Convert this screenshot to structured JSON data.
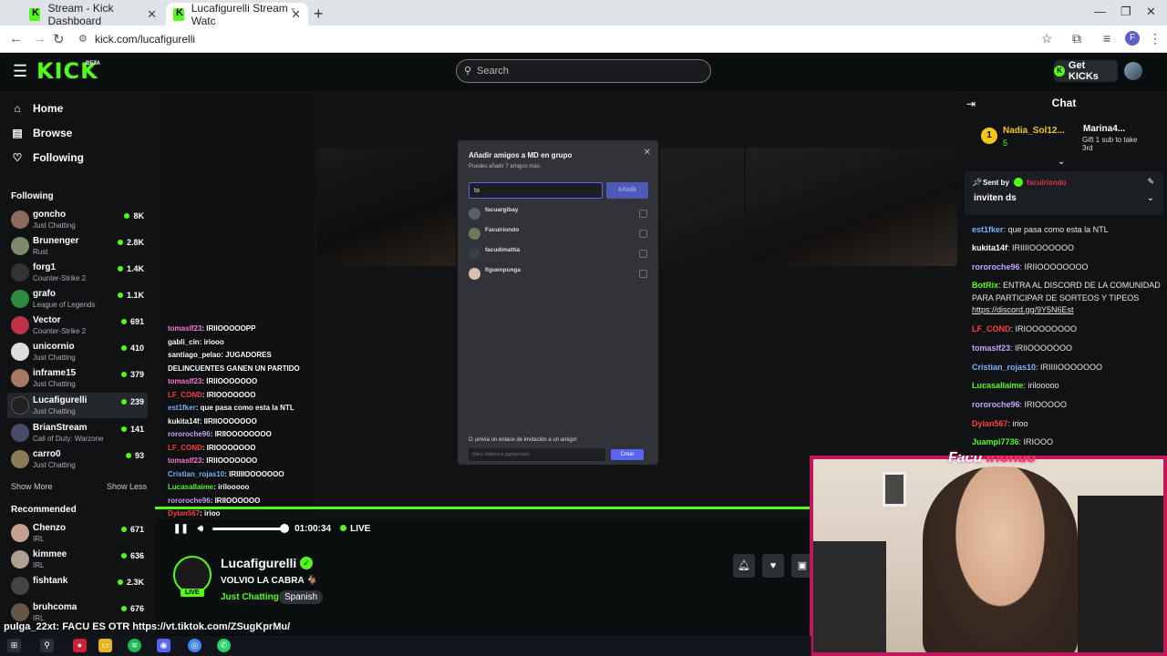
{
  "browser": {
    "tabs": [
      {
        "title": "Stream - Kick Dashboard"
      },
      {
        "title": "Lucafigurelli Stream - Watc"
      }
    ],
    "url": "kick.com/lucafigurelli",
    "profile_letter": "F"
  },
  "header": {
    "logo": "KICK",
    "beta": "BETA",
    "search_placeholder": "Search",
    "get_kicks": "Get KICKs"
  },
  "sidebar": {
    "nav": [
      {
        "label": "Home",
        "icon": "home-icon"
      },
      {
        "label": "Browse",
        "icon": "browse-icon"
      },
      {
        "label": "Following",
        "icon": "heart-icon"
      }
    ],
    "following_title": "Following",
    "following": [
      {
        "name": "goncho",
        "category": "Just Chatting",
        "viewers": "8K"
      },
      {
        "name": "Brunenger",
        "category": "Rust",
        "viewers": "2.8K"
      },
      {
        "name": "forg1",
        "category": "Counter-Strike 2",
        "viewers": "1.4K"
      },
      {
        "name": "grafo",
        "category": "League of Legends",
        "viewers": "1.1K"
      },
      {
        "name": "Vector",
        "category": "Counter-Strike 2",
        "viewers": "691"
      },
      {
        "name": "unicornio",
        "category": "Just Chatting",
        "viewers": "410"
      },
      {
        "name": "inframe15",
        "category": "Just Chatting",
        "viewers": "379"
      },
      {
        "name": "Lucafigurelli",
        "category": "Just Chatting",
        "viewers": "239"
      },
      {
        "name": "BrianStream",
        "category": "Call of Duty: Warzone",
        "viewers": "141"
      },
      {
        "name": "carro0",
        "category": "Just Chatting",
        "viewers": "93"
      }
    ],
    "show_more": "Show More",
    "show_less": "Show Less",
    "recommended_title": "Recommended",
    "recommended": [
      {
        "name": "Chenzo",
        "category": "IRL",
        "viewers": "671"
      },
      {
        "name": "kimmee",
        "category": "IRL",
        "viewers": "636"
      },
      {
        "name": "fishtank",
        "category": "",
        "viewers": "2.3K"
      },
      {
        "name": "bruhcoma",
        "category": "IRL",
        "viewers": "676"
      }
    ]
  },
  "discord_modal": {
    "title": "Añadir amigos a MD en grupo",
    "subtitle": "Puedes añadir 7 amigos más.",
    "input_value": "fa",
    "add_button": "Añadir",
    "friends": [
      {
        "name": "facuargibay"
      },
      {
        "name": "Facuiriondo"
      },
      {
        "name": "facudimattia"
      },
      {
        "name": "figuenpunga"
      }
    ],
    "invite_label": "O ¡envía un enlace de invitación a un amigo!",
    "invite_placeholder": "https://discord.gg/ejemplo",
    "create_button": "Crear"
  },
  "stream_overlay_chat": [
    {
      "user": "tomaslf23",
      "text": ": IRIIOOOOOPP",
      "color": "#ff7ad9"
    },
    {
      "user": "gabli_cin",
      "text": ": iriooo",
      "color": "#ffffff"
    },
    {
      "user": "santiago_pelao",
      "text": ": JUGADORES",
      "color": "#ffffff"
    },
    {
      "user": "",
      "text": "DELINCUENTES GANEN UN PARTIDO",
      "color": "#ffffff"
    },
    {
      "user": "tomaslf23",
      "text": ": IRIIOOOOOOO",
      "color": "#ff7ad9"
    },
    {
      "user": "LF_COND",
      "text": ": IRIOOOOOOO",
      "color": "#ff4040"
    },
    {
      "user": "est1fker",
      "text": ": que pasa como esta la NTL",
      "color": "#7ab4ff"
    },
    {
      "user": "kukita14f",
      "text": ": IIRIIOOOOOOO",
      "color": "#ffffff"
    },
    {
      "user": "rororoche96",
      "text": ": IRIIOOOOOOOO",
      "color": "#c7a3ff"
    },
    {
      "user": "LF_COND",
      "text": ": IRIOOOOOOO",
      "color": "#ff4040"
    },
    {
      "user": "tomaslf23",
      "text": ": IRIIOOOOOOO",
      "color": "#ff7ad9"
    },
    {
      "user": "Cristian_rojas10",
      "text": ": IRIIIIOOOOOOO",
      "color": "#7ab4ff"
    },
    {
      "user": "Lucasallaime",
      "text": ": irilooooo",
      "color": "#53fc18"
    },
    {
      "user": "rororoche96",
      "text": ": IRIIOOOOOO",
      "color": "#c7a3ff"
    },
    {
      "user": "Dylan567",
      "text": ": irioo",
      "color": "#ff4040"
    }
  ],
  "player": {
    "time": "01:00:34",
    "live": "LIVE",
    "volume_percent": 100
  },
  "channel": {
    "name": "Lucafigurelli",
    "live_badge": "LIVE",
    "title": "VOLVIO LA CABRA 🐐",
    "category": "Just Chatting",
    "language": "Spanish"
  },
  "webcam": {
    "title_first": "Facu ",
    "title_second": "Iriondo"
  },
  "chat": {
    "title": "Chat",
    "leaderboard": [
      {
        "rank": "1",
        "user": "Nadia_Sol12...",
        "count": "5"
      },
      {
        "user": "Marina4...",
        "line1": "Gift 1 sub to take",
        "line2": "3rd"
      }
    ],
    "pinned_sender_label": "Sent by",
    "pinned_sender": "facuiriondo",
    "pinned_text": "inviten ds",
    "messages": [
      {
        "user": "est1fker",
        "text": ": que pasa como esta la NTL",
        "color": "#7ab4ff"
      },
      {
        "user": "kukita14f",
        "text": ": IRIIIIOOOOOOO",
        "color": "#ffffff"
      },
      {
        "user": "rororoche96",
        "text": ": IRIIOOOOOOOO",
        "color": "#c7a3ff"
      },
      {
        "user": "BotRix",
        "text": ": ENTRA AL DISCORD DE LA COMUNIDAD PARA PARTICIPAR DE SORTEOS Y TIPEOS ",
        "link": "https://discord.gg/9Y5N6Est",
        "color": "#53fc18"
      },
      {
        "user": "LF_COND",
        "text": ": IRIOOOOOOOO",
        "color": "#ff4040"
      },
      {
        "user": "tomaslf23",
        "text": ": IRIIOOOOOOO",
        "color": "#c7a3ff"
      },
      {
        "user": "Cristian_rojas10",
        "text": ": IRIIIIOOOOOOO",
        "color": "#7ab4ff"
      },
      {
        "user": "Lucasallaime",
        "text": ": irilooooo",
        "color": "#53fc18"
      },
      {
        "user": "rororoche96",
        "text": ": IRIOOOOO",
        "color": "#c7a3ff"
      },
      {
        "user": "Dylan567",
        "text": ": irioo",
        "color": "#ff4040"
      },
      {
        "user": "Juampi7736",
        "text": ": IRIOOO",
        "color": "#53fc18"
      }
    ]
  },
  "bottom_overlay": {
    "line_user": "pulga_22xt",
    "line_text": ": FACU ES OTR https://vt.tiktok.com/ZSugKprMu/"
  },
  "colors": {
    "kick_green": "#53fc18",
    "discord_blurple": "#5865f2",
    "webcam_border": "#c1175a"
  }
}
